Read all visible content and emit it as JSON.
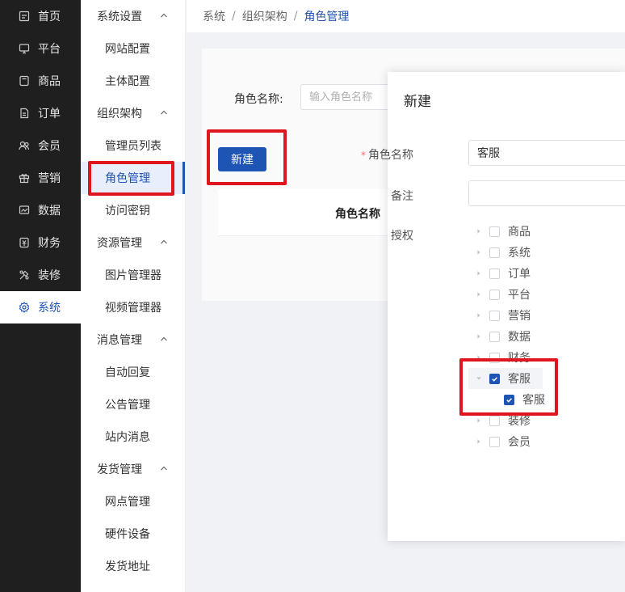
{
  "nav": {
    "items": [
      {
        "label": "首页",
        "icon": "home-icon"
      },
      {
        "label": "平台",
        "icon": "monitor-icon"
      },
      {
        "label": "商品",
        "icon": "goods-icon"
      },
      {
        "label": "订单",
        "icon": "order-icon"
      },
      {
        "label": "会员",
        "icon": "member-icon"
      },
      {
        "label": "营销",
        "icon": "gift-icon"
      },
      {
        "label": "数据",
        "icon": "chart-icon"
      },
      {
        "label": "财务",
        "icon": "finance-icon"
      },
      {
        "label": "装修",
        "icon": "decorate-icon"
      },
      {
        "label": "系统",
        "icon": "gear-icon"
      }
    ],
    "active_index": 9
  },
  "submenu": {
    "groups": [
      {
        "label": "系统设置",
        "items": [
          "网站配置",
          "主体配置"
        ]
      },
      {
        "label": "组织架构",
        "items": [
          "管理员列表",
          "角色管理",
          "访问密钥"
        ]
      },
      {
        "label": "资源管理",
        "items": [
          "图片管理器",
          "视频管理器"
        ]
      },
      {
        "label": "消息管理",
        "items": [
          "自动回复",
          "公告管理",
          "站内消息"
        ]
      },
      {
        "label": "发货管理",
        "items": [
          "网点管理",
          "硬件设备",
          "发货地址"
        ]
      }
    ],
    "active_item": "角色管理"
  },
  "breadcrumb": {
    "items": [
      "系统",
      "组织架构"
    ],
    "current": "角色管理",
    "separator": "/"
  },
  "main": {
    "filter_label": "角色名称:",
    "filter_placeholder": "输入角色名称",
    "new_button": "新建",
    "table_headers": [
      "角色名称"
    ]
  },
  "modal": {
    "title": "新建",
    "role_label": "角色名称",
    "role_value": "客服",
    "remark_label": "备注",
    "remark_value": "",
    "auth_label": "授权",
    "tree": [
      {
        "label": "商品",
        "checked": false,
        "expanded": false
      },
      {
        "label": "系统",
        "checked": false,
        "expanded": false
      },
      {
        "label": "订单",
        "checked": false,
        "expanded": false
      },
      {
        "label": "平台",
        "checked": false,
        "expanded": false
      },
      {
        "label": "营销",
        "checked": false,
        "expanded": false
      },
      {
        "label": "数据",
        "checked": false,
        "expanded": false
      },
      {
        "label": "财务",
        "checked": false,
        "expanded": false
      },
      {
        "label": "客服",
        "checked": true,
        "expanded": true,
        "children": [
          {
            "label": "客服",
            "checked": true
          }
        ]
      },
      {
        "label": "装修",
        "checked": false,
        "expanded": false
      },
      {
        "label": "会员",
        "checked": false,
        "expanded": false
      }
    ]
  },
  "colors": {
    "primary": "#1e54b4",
    "nav_bg": "#1f1f1f",
    "annotation": "#e0161e"
  }
}
